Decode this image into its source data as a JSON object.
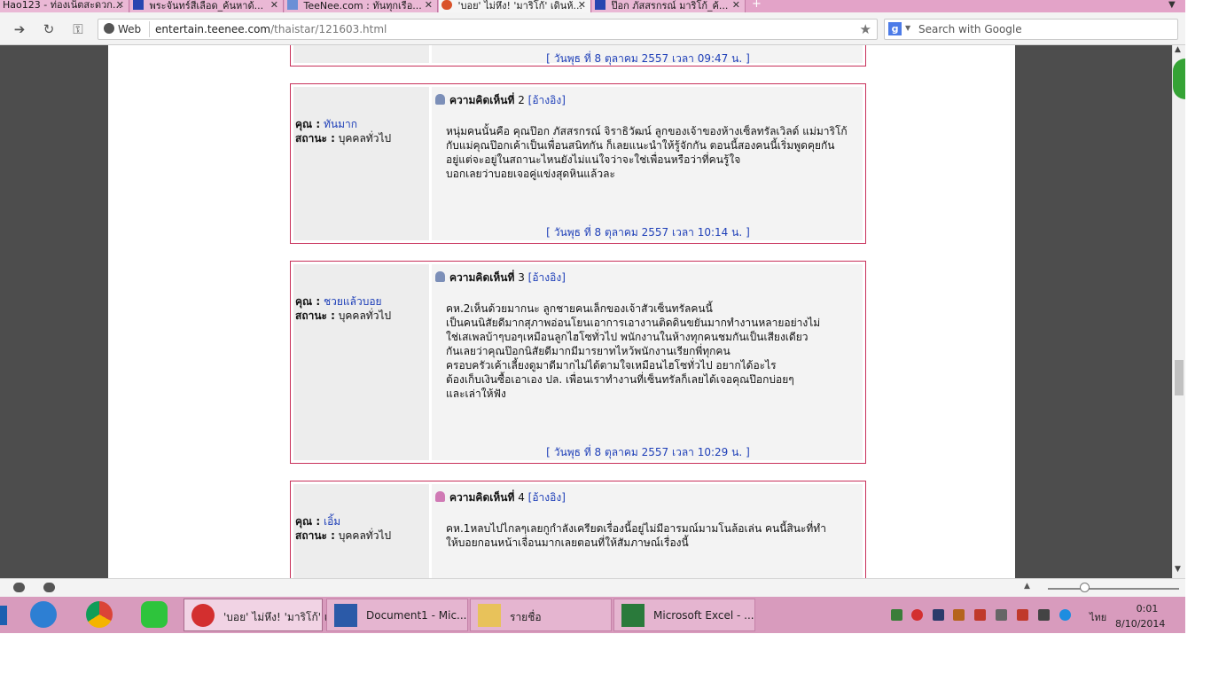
{
  "browser": {
    "tabs": [
      {
        "label": "Hao123 - ท่องเน็ตสะดวก...",
        "icon": "none",
        "active": false
      },
      {
        "label": "พระจันทร์สีเลือด_ค้นหาด้...",
        "icon": "paw",
        "active": false
      },
      {
        "label": "TeeNee.com : ทันทุกเรือ...",
        "icon": "teenee",
        "active": false
      },
      {
        "label": "'บอย' ไม่หึง! 'มาริโก้' เดินห้...",
        "icon": "opera",
        "active": true
      },
      {
        "label": "ป๊อก ภัสสรกรณ์ มาริโก้_ค้...",
        "icon": "paw",
        "active": false
      }
    ],
    "close_glyph": "✕",
    "new_tab_glyph": "+",
    "menu_glyph": "▼",
    "back_glyph": "➔",
    "reload_glyph": "↻",
    "key_glyph": "⚿",
    "web_badge": "Web",
    "url_domain": "entertain.teenee.com",
    "url_path": "/thaistar/121603.html",
    "star_glyph": "★",
    "search_logo": "g",
    "search_placeholder": "Search with Google"
  },
  "page": {
    "prev_date": "วันพุธ ที่ 8 ตุลาคม 2557 เวลา 09:47 น.",
    "comments": [
      {
        "heading": "ความคิดเห็นที่",
        "number": "2",
        "quote": "[อ้างอิง]",
        "author_label": "คุณ :",
        "author": "ทันมาก",
        "status_label": "สถานะ :",
        "status": "บุคคลทั่วไป",
        "lines": [
          "หนุ่มคนนั้นคือ คุณป๊อก ภัสสรกรณ์ จิราธิวัฒน์ ลูกของเจ้าของห้างเซ็ลทรัลเวิลด์ แม่มาริโก้",
          "กับแม่คุณป๊อกเค้าเป็นเพื่อนสนิทกัน ก็เลยแนะนำให้รู้จักกัน ตอนนี้สองคนนี้เริ่มพูดคุยกัน",
          "อยู่แต่จะอยู่ในสถานะไหนยังไม่แน่ใจว่าจะใช่เพื่อนหรือว่าที่คนรู้ใจ",
          "บอกเลยว่าบอยเจอคู่แข่งสุดหินแล้วละ"
        ],
        "date": "วันพุธ ที่ 8 ตุลาคม 2557 เวลา 10:14 น."
      },
      {
        "heading": "ความคิดเห็นที่",
        "number": "3",
        "quote": "[อ้างอิง]",
        "author_label": "คุณ :",
        "author": "ชวยแล้วบอย",
        "status_label": "สถานะ :",
        "status": "บุคคลทั่วไป",
        "lines": [
          "คห.2เห็นด้วยมากนะ ลูกชายคนเล็กของเจ้าสัวเซ็นทรัลคนนี้",
          "เป็นคนนิสัยดีมากสุภาพอ่อนโยนเอาการเอางานติดดินขยันมากทำงานหลายอย่างไม่",
          "ใช่เสเพลบ้าๆบอๆเหมือนลูกไฮโซทั่วไป พนักงานในห้างทุกคนชมกันเป็นเสียงเดียว",
          "กันเลยว่าคุณป๊อกนิสัยดีมากมีมารยาทไหว้พนักงานเรียกพี่ทุกคน",
          "ครอบครัวเค้าเลี้ยงดูมาดีมากไม่ได้ตามใจเหมือนไฮโซทั่วไป อยากได้อะไร",
          "ต้องเก็บเงินซื้อเอาเอง ปล. เพื่อนเราทำงานที่เซ็นทรัลก็เลยได้เจอคุณป๊อกบ่อยๆ",
          "และเล่าให้ฟัง"
        ],
        "date": "วันพุธ ที่ 8 ตุลาคม 2557 เวลา 10:29 น."
      },
      {
        "heading": "ความคิดเห็นที่",
        "number": "4",
        "quote": "[อ้างอิง]",
        "author_label": "คุณ :",
        "author": "เอิ้ม",
        "status_label": "สถานะ :",
        "status": "บุคคลทั่วไป",
        "lines": [
          "คห.1หลบไปไกลๆเลยกูกำลังเครียดเรื่องนี้อยู่ไม่มีอารมณ์มามโนล้อเล่น คนนี้สินะที่ทำ",
          "ให้บอยกอนหน้าเจื่อนมากเลยตอนที่ให้สัมภาษณ์เรื่องนี้"
        ],
        "date": ""
      }
    ]
  },
  "statusbar": {
    "zoom_fraction": 0.28
  },
  "taskbar": {
    "tasks": [
      {
        "label": "'บอย' ไม่หึง! 'มาริโก้' เ...",
        "icon": "opera-icon",
        "active": true
      },
      {
        "label": "Document1 - Mic...",
        "icon": "word-icon",
        "active": false
      },
      {
        "label": "รายชื่อ",
        "icon": "folder-icon",
        "active": false
      },
      {
        "label": "Microsoft Excel - ...",
        "icon": "excel-icon",
        "active": false
      }
    ],
    "language": "ไทย",
    "time": "0:01",
    "date": "8/10/2014"
  },
  "colors": {
    "tab_bar": "#e3a3c8",
    "taskbar": "#d89bbd",
    "comment_border": "#c8305a",
    "link_blue": "#1e3fb8"
  }
}
